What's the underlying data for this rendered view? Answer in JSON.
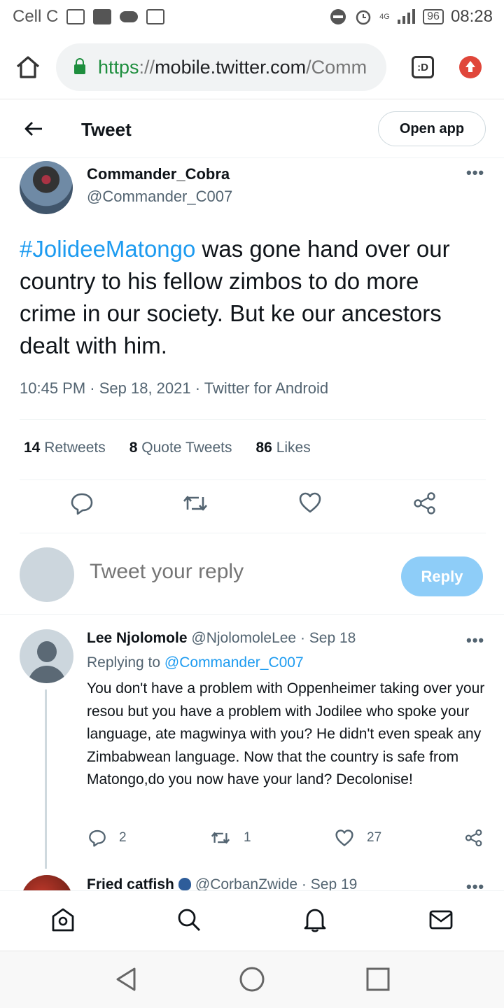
{
  "status_bar": {
    "carrier": "Cell C",
    "network": "4G",
    "battery": "96",
    "time": "08:28"
  },
  "browser": {
    "url_scheme": "https",
    "url_sep": "://",
    "url_host": "mobile.twitter.com",
    "url_path": "/Comm",
    "tab_label": ":D"
  },
  "header": {
    "title": "Tweet",
    "open_app_label": "Open app"
  },
  "tweet": {
    "author_name": "Commander_Cobra",
    "author_handle": "@Commander_C007",
    "hashtag": "#JolideeMatongo",
    "text_rest": " was gone hand over our country to his fellow zimbos to do more crime in our society. But ke our ancestors dealt with him.",
    "meta": "10:45 PM · Sep 18, 2021 · Twitter for Android",
    "retweets_count": "14",
    "retweets_label": "Retweets",
    "quote_count": "8",
    "quote_label": "Quote Tweets",
    "likes_count": "86",
    "likes_label": "Likes"
  },
  "composer": {
    "placeholder": "Tweet your reply",
    "reply_label": "Reply"
  },
  "replies": [
    {
      "name": "Lee Njolomole",
      "handle": "@NjolomoleLee",
      "sep": " · ",
      "date": "Sep 18",
      "replying_prefix": "Replying to ",
      "replying_to": "@Commander_C007",
      "text": "You don't have a problem with  Oppenheimer taking over your resou but you have a problem with Jodilee who spoke your language, ate magwinya with you? He didn't even speak any Zimbabwean language.  Now that the country is safe from  Matongo,do you now have your land? Decolonise!",
      "reply_count": "2",
      "retweet_count": "1",
      "like_count": "27"
    },
    {
      "name": "Fried catfish",
      "handle": "@CorbanZwide",
      "sep": " · ",
      "date": "Sep 19"
    }
  ],
  "icons": {
    "home": "home-icon",
    "search": "search-icon",
    "notifications": "bell-icon",
    "messages": "mail-icon"
  },
  "colors": {
    "accent": "#1d9bf0",
    "reply_button": "#8ecdf8",
    "secondary_text": "#536471"
  }
}
